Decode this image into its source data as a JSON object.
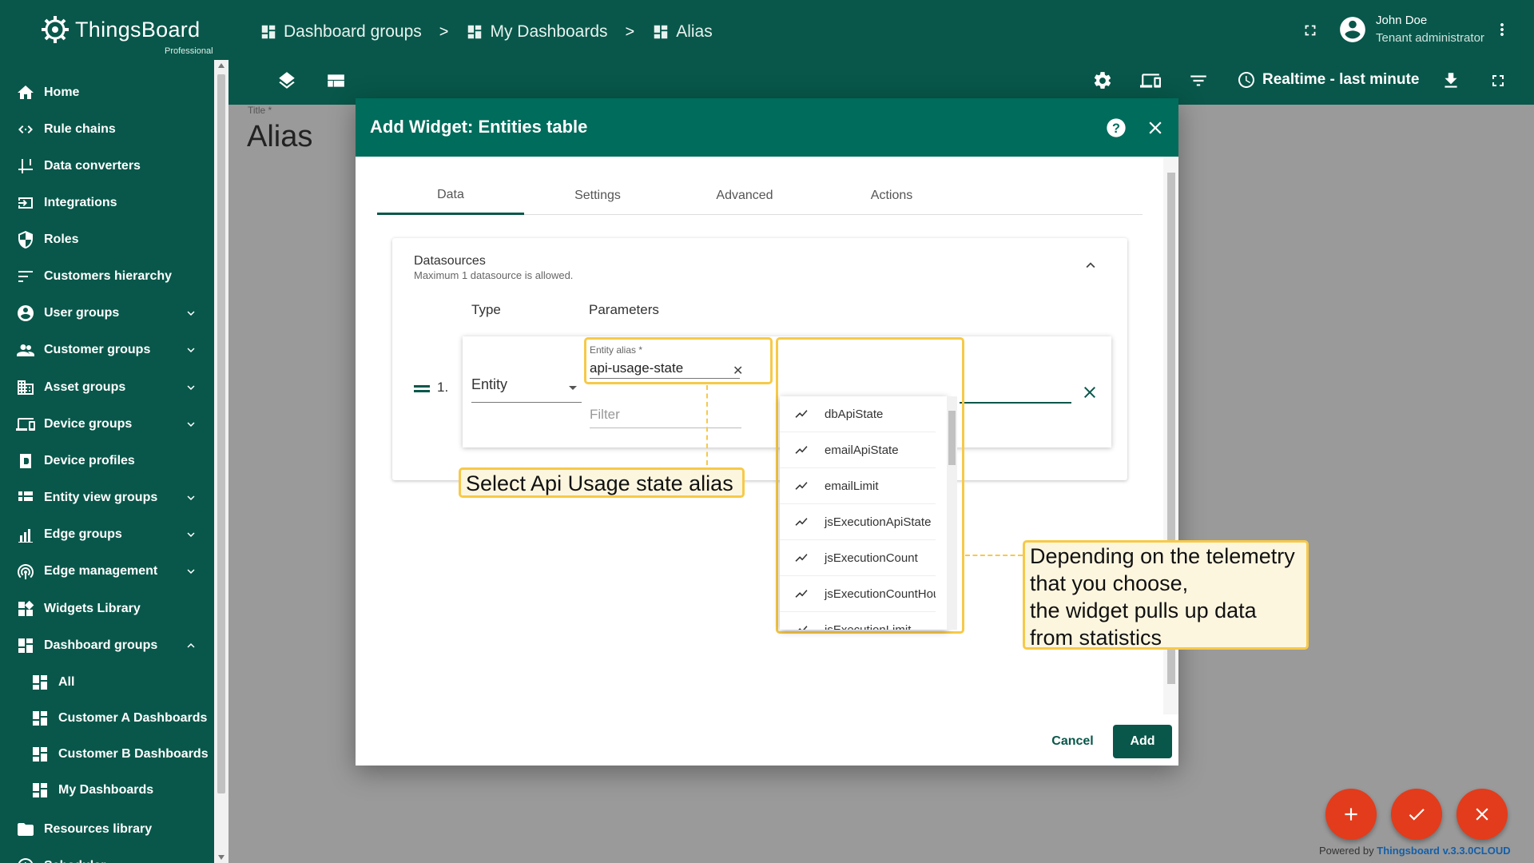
{
  "app": {
    "logo_name": "ThingsBoard",
    "logo_sub": "Professional"
  },
  "breadcrumbs": [
    {
      "label": "Dashboard groups",
      "icon": "dashboard-icon"
    },
    {
      "label": "My Dashboards",
      "icon": "dashboard-icon"
    },
    {
      "label": "Alias",
      "icon": "dashboard-icon"
    }
  ],
  "breadcrumb_separator": ">",
  "user": {
    "name": "John Doe",
    "role": "Tenant administrator"
  },
  "toolbar": {
    "timewindow": "Realtime - last minute"
  },
  "sidebar": {
    "items": [
      {
        "label": "Home",
        "icon": "home-icon"
      },
      {
        "label": "Rule chains",
        "icon": "rule-chains-icon"
      },
      {
        "label": "Data converters",
        "icon": "data-converters-icon"
      },
      {
        "label": "Integrations",
        "icon": "integrations-icon"
      },
      {
        "label": "Roles",
        "icon": "roles-icon"
      },
      {
        "label": "Customers hierarchy",
        "icon": "hierarchy-icon"
      },
      {
        "label": "User groups",
        "icon": "user-groups-icon"
      },
      {
        "label": "Customer groups",
        "icon": "customer-groups-icon"
      },
      {
        "label": "Asset groups",
        "icon": "asset-groups-icon"
      },
      {
        "label": "Device groups",
        "icon": "device-groups-icon"
      },
      {
        "label": "Device profiles",
        "icon": "device-profiles-icon"
      },
      {
        "label": "Entity view groups",
        "icon": "entity-view-groups-icon"
      },
      {
        "label": "Edge groups",
        "icon": "edge-groups-icon"
      },
      {
        "label": "Edge management",
        "icon": "edge-management-icon"
      },
      {
        "label": "Widgets Library",
        "icon": "widgets-library-icon"
      },
      {
        "label": "Dashboard groups",
        "icon": "dashboard-groups-icon"
      },
      {
        "label": "All",
        "icon": "dashboard-icon"
      },
      {
        "label": "Customer A Dashboards",
        "icon": "dashboard-icon"
      },
      {
        "label": "Customer B Dashboards",
        "icon": "dashboard-icon"
      },
      {
        "label": "My Dashboards",
        "icon": "dashboard-icon"
      },
      {
        "label": "Resources library",
        "icon": "folder-icon"
      },
      {
        "label": "Scheduler",
        "icon": "clock-icon"
      }
    ]
  },
  "dashboard": {
    "title_label": "Title *",
    "title": "Alias"
  },
  "modal": {
    "title": "Add Widget: Entities table",
    "tabs": [
      "Data",
      "Settings",
      "Advanced",
      "Actions"
    ],
    "active_tab": "Data",
    "datasources": {
      "title": "Datasources",
      "hint": "Maximum 1 datasource is allowed.",
      "col_type": "Type",
      "col_params": "Parameters",
      "row_index": "1.",
      "type_value": "Entity",
      "alias_label": "Entity alias *",
      "alias_value": "api-usage-state",
      "filter_placeholder": "Filter"
    },
    "keys_dropdown": [
      "dbApiState",
      "emailApiState",
      "emailLimit",
      "jsExecutionApiState",
      "jsExecutionCount",
      "jsExecutionCountHou",
      "jsExecutionLimit"
    ],
    "cancel_label": "Cancel",
    "add_label": "Add"
  },
  "callouts": {
    "alias": "Select Api Usage state alias",
    "telemetry": [
      "Depending on the telemetry",
      "that you choose,",
      "the widget pulls up data",
      "from statistics"
    ]
  },
  "footer": {
    "powered_prefix": "Powered by",
    "powered_brand": "Thingsboard v.3.3.0CLOUD"
  },
  "colors": {
    "primary": "#08574a",
    "header": "#006c5b",
    "accent": "#f7c948",
    "fab": "#e23c1c"
  }
}
